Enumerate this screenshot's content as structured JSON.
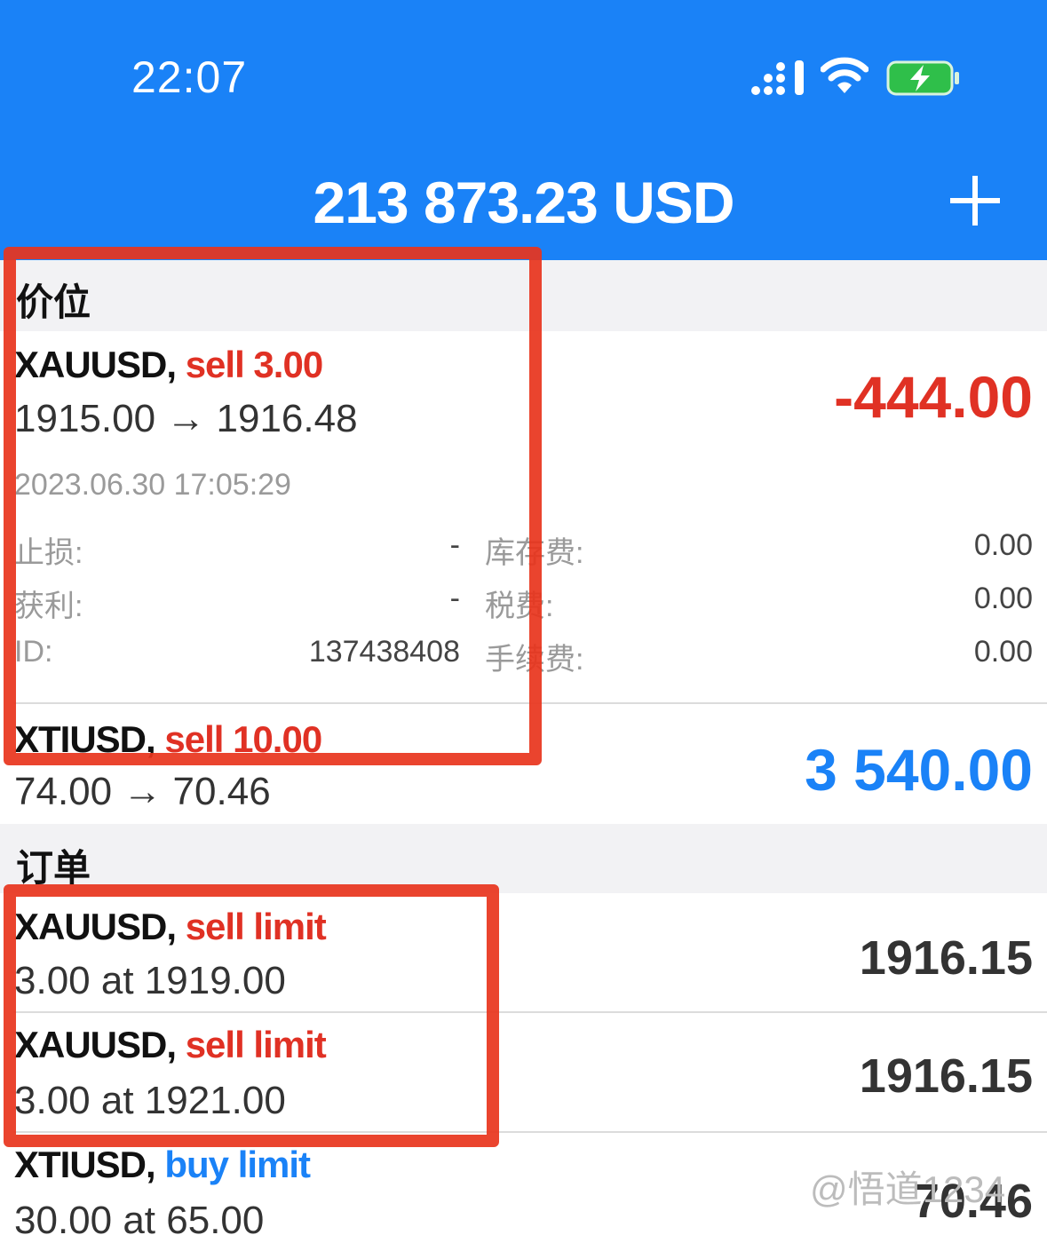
{
  "status_bar": {
    "time": "22:07"
  },
  "header": {
    "balance": "213 873.23 USD"
  },
  "positions": {
    "title": "价位",
    "items": [
      {
        "symbol": "XAUUSD,",
        "side": "sell 3.00",
        "prices": "1915.00 → 1916.48",
        "profit": "-444.00",
        "time": "2023.06.30 17:05:29",
        "details": {
          "sl_label": "止损:",
          "sl_value": "-",
          "tp_label": "获利:",
          "tp_value": "-",
          "id_label": "ID:",
          "id_value": "137438408",
          "swap_label": "库存费:",
          "swap_value": "0.00",
          "tax_label": "税费:",
          "tax_value": "0.00",
          "commission_label": "手续费:",
          "commission_value": "0.00"
        }
      },
      {
        "symbol": "XTIUSD,",
        "side": "sell 10.00",
        "prices": "74.00 → 70.46",
        "profit": "3 540.00"
      }
    ]
  },
  "orders": {
    "title": "订单",
    "items": [
      {
        "symbol": "XAUUSD,",
        "side": "sell limit",
        "detail": "3.00 at 1919.00",
        "price": "1916.15"
      },
      {
        "symbol": "XAUUSD,",
        "side": "sell limit",
        "detail": "3.00 at 1921.00",
        "price": "1916.15"
      },
      {
        "symbol": "XTIUSD,",
        "side": "buy limit",
        "detail": "30.00 at 65.00",
        "price": "70.46"
      }
    ]
  },
  "watermark": "@悟道1234",
  "colors": {
    "header_blue": "#1a82f7",
    "loss_red": "#e03124",
    "profit_blue": "#1a82f7",
    "annotation_red": "#e8341c"
  }
}
